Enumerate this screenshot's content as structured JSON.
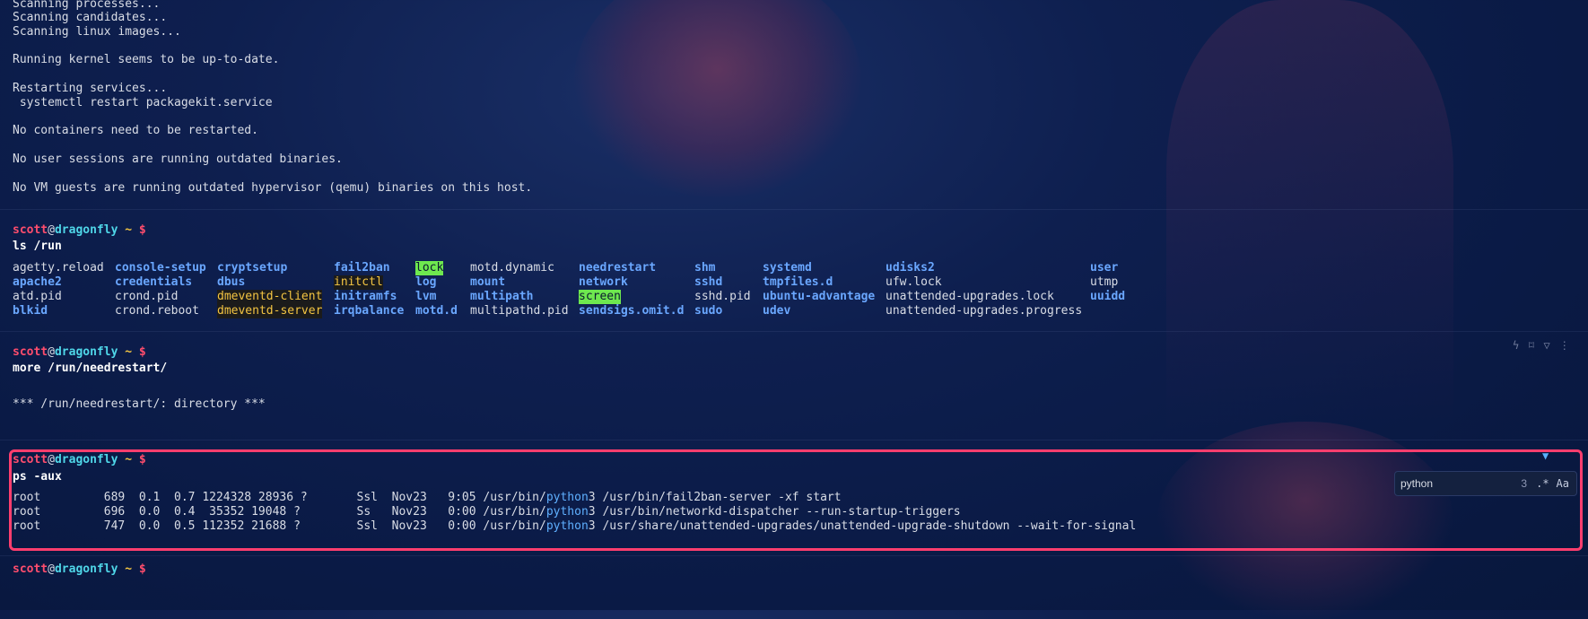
{
  "prompt": {
    "user": "scott",
    "at": "@",
    "host": "dragonfly",
    "tilde": "~",
    "dollar": "$"
  },
  "output_top": [
    "Scanning processes...",
    "Scanning candidates...",
    "Scanning linux images...",
    "",
    "Running kernel seems to be up-to-date.",
    "",
    "Restarting services...",
    " systemctl restart packagekit.service",
    "",
    "No containers need to be restarted.",
    "",
    "No user sessions are running outdated binaries.",
    "",
    "No VM guests are running outdated hypervisor (qemu) binaries on this host."
  ],
  "block1": {
    "command": "ls /run"
  },
  "ls": {
    "col1": [
      "agetty.reload",
      "apache2",
      "atd.pid",
      "blkid"
    ],
    "col2": [
      "console-setup",
      "credentials",
      "crond.pid",
      "crond.reboot"
    ],
    "col3": [
      "cryptsetup",
      "dbus",
      "dmeventd-client",
      "dmeventd-server"
    ],
    "col4": [
      "fail2ban",
      "initctl",
      "initramfs",
      "irqbalance"
    ],
    "col5": [
      "lock",
      "log",
      "lvm",
      "motd.d"
    ],
    "col6": [
      "motd.dynamic",
      "mount",
      "multipath",
      "multipathd.pid"
    ],
    "col7": [
      "needrestart",
      "network",
      "screen",
      "sendsigs.omit.d"
    ],
    "col8": [
      "shm",
      "sshd",
      "sshd.pid",
      "sudo"
    ],
    "col9": [
      "systemd",
      "tmpfiles.d",
      "ubuntu-advantage",
      "udev"
    ],
    "col10": [
      "udisks2",
      "ufw.lock",
      "unattended-upgrades.lock",
      "unattended-upgrades.progress"
    ],
    "col11": [
      "user",
      "utmp",
      "uuidd",
      ""
    ]
  },
  "block2": {
    "command": "more /run/needrestart/",
    "output": "*** /run/needrestart/: directory ***"
  },
  "block3": {
    "command": "ps -aux",
    "rows": [
      {
        "pre": "root         689  0.1  0.7 1224328 28936 ?       Ssl  Nov23   9:05 /usr/bin/",
        "match": "python",
        "post": "3 /usr/bin/fail2ban-server -xf start"
      },
      {
        "pre": "root         696  0.0  0.4  35352 19048 ?        Ss   Nov23   0:00 /usr/bin/",
        "match": "python",
        "post": "3 /usr/bin/networkd-dispatcher --run-startup-triggers"
      },
      {
        "pre": "root         747  0.0  0.5 112352 21688 ?        Ssl  Nov23   0:00 /usr/bin/",
        "match": "python",
        "post": "3 /usr/share/unattended-upgrades/unattended-upgrade-shutdown --wait-for-signal"
      }
    ]
  },
  "find": {
    "value": "python",
    "count": "3",
    "regex_label": ".*",
    "case_label": "Aa"
  },
  "block_icons": [
    "bolt-icon",
    "bookmark-icon",
    "filter-icon",
    "more-icon"
  ]
}
